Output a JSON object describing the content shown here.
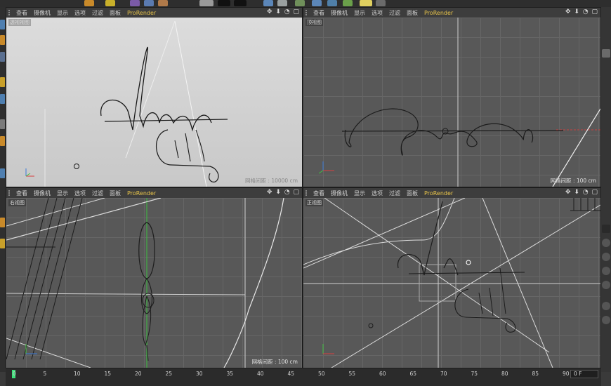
{
  "menu": [
    "查看",
    "摄像机",
    "显示",
    "选项",
    "过滤",
    "面板",
    "ProRender"
  ],
  "viewports": [
    {
      "label": "透视视图",
      "foot": "网格间距 : 10000 cm"
    },
    {
      "label": "顶视图",
      "foot": "网格间距 : 100 cm"
    },
    {
      "label": "右视图",
      "foot": "网格间距 : 100 cm"
    },
    {
      "label": "正视图",
      "foot": ""
    }
  ],
  "viewport_controls": "✥ ⬇ ◔ ▢",
  "timeline": {
    "ticks": [
      "0",
      "5",
      "10",
      "15",
      "20",
      "25",
      "30",
      "35",
      "40",
      "45",
      "50",
      "55",
      "60",
      "65",
      "70",
      "75",
      "80",
      "85",
      "90"
    ],
    "current_frame": "0 F"
  },
  "colors": {
    "accent": "#e8c44a",
    "grid_bg": "#585858",
    "persp_bg": "#d2d2d2",
    "timeline_marker": "#3ce07a"
  }
}
